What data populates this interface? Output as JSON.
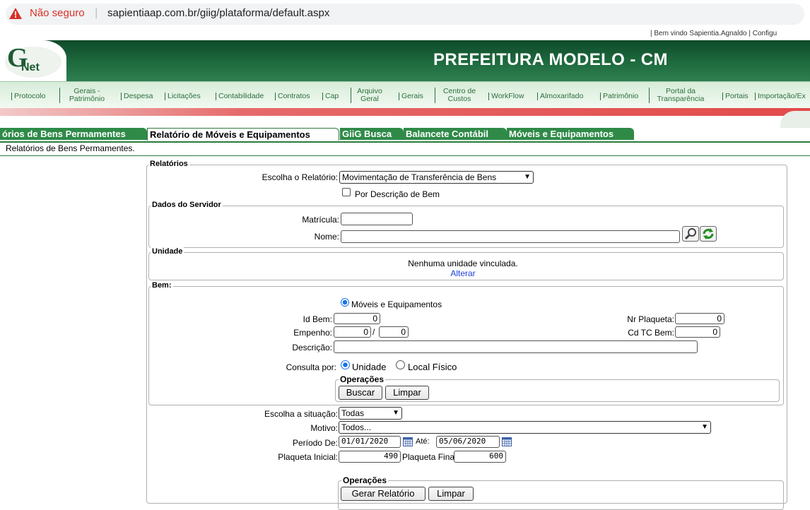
{
  "browser": {
    "security_label": "Não seguro",
    "url": "sapientiaap.com.br/giig/plataforma/default.aspx"
  },
  "header": {
    "top_links": "|  Bem vindo Sapientia.Agnaldo   |  Configu",
    "title": "PREFEITURA MODELO - CM",
    "logo_text": "Net"
  },
  "menu": [
    {
      "label": "Protocolo"
    },
    {
      "label": "Gerais - Patrimônio"
    },
    {
      "label": "Despesa"
    },
    {
      "label": "Licitações"
    },
    {
      "label": "Contabilidade"
    },
    {
      "label": "Contratos"
    },
    {
      "label": "Cap"
    },
    {
      "label": "Arquivo Geral"
    },
    {
      "label": "Gerais"
    },
    {
      "label": "Centro de Custos"
    },
    {
      "label": "WorkFlow"
    },
    {
      "label": "Almoxarifado"
    },
    {
      "label": "Patrimônio"
    },
    {
      "label": "Portal da Transparência"
    },
    {
      "label": "Portais"
    },
    {
      "label": "Importação/Ex"
    }
  ],
  "tabs": [
    {
      "label": "órios de Bens Permamentes"
    },
    {
      "label": "Relatório de Móveis e Equipamentos"
    },
    {
      "label": "GiiG Busca"
    },
    {
      "label": "Balancete Contábil"
    },
    {
      "label": "Móveis e Equipamentos"
    }
  ],
  "breadcrumb": "Relatórios de Bens Permamentes.",
  "relatorios": {
    "legend": "Relatórios",
    "choose_label": "Escolha o Relatório:",
    "choose_value": "Movimentação de Transferência de Bens",
    "por_descricao_label": "Por Descrição de Bem"
  },
  "servidor": {
    "legend": "Dados do Servidor",
    "matricula_label": "Matrícula:",
    "nome_label": "Nome:"
  },
  "unidade": {
    "legend": "Unidade",
    "message": "Nenhuma unidade vinculada.",
    "alterar": "Alterar"
  },
  "bem": {
    "legend": "Bem:",
    "radio_label": "Móveis e Equipamentos",
    "id_label": "Id Bem:",
    "id_value": "0",
    "empenho_label": "Empenho:",
    "empenho1": "0",
    "empenho_sep": "/",
    "empenho2": "0",
    "descricao_label": "Descrição:",
    "nr_plaqueta_label": "Nr Plaqueta:",
    "nr_plaqueta_value": "0",
    "cd_tc_label": "Cd TC Bem:",
    "cd_tc_value": "0",
    "consulta_label": "Consulta por:",
    "opt_unidade": "Unidade",
    "opt_local": "Local Físico",
    "operacoes_legend": "Operações",
    "buscar": "Buscar",
    "limpar": "Limpar"
  },
  "filtros": {
    "situacao_label": "Escolha a situação:",
    "situacao_value": "Todas",
    "motivo_label": "Motivo:",
    "motivo_value": "Todos...",
    "periodo_label": "Período De:",
    "periodo_de": "01/01/2020",
    "ate_label": "Até:",
    "periodo_ate": "05/06/2020",
    "plaqueta_ini_label": "Plaqueta Inicial:",
    "plaqueta_ini": "490",
    "plaqueta_fin_label": "Plaqueta Final:",
    "plaqueta_fin": "600",
    "operacoes_legend": "Operações",
    "gerar": "Gerar Relatório",
    "limpar": "Limpar"
  }
}
